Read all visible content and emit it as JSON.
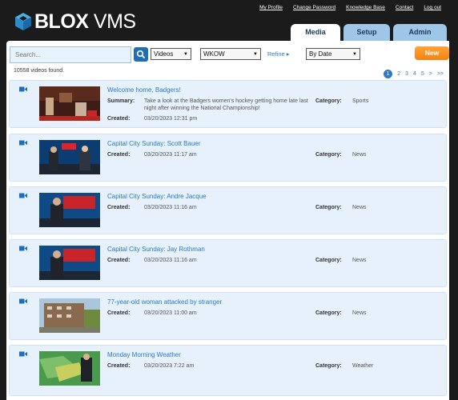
{
  "brand": {
    "name_bold": "BLOX",
    "name_thin": " VMS"
  },
  "toplinks": [
    "My Profile",
    "Change Password",
    "Knowledge Base",
    "Contact",
    "Log out"
  ],
  "tabs": [
    {
      "label": "Media",
      "active": true
    },
    {
      "label": "Setup",
      "active": false
    },
    {
      "label": "Admin",
      "active": false
    }
  ],
  "toolbar": {
    "search_placeholder": "Search...",
    "type_value": "Videos",
    "station_value": "WKOW",
    "refine_label": "Refine ▸",
    "sort_value": "By Date",
    "new_label": "New"
  },
  "results": {
    "count_text": "10558 videos found."
  },
  "pager": {
    "current": "1",
    "pages": [
      "2",
      "3",
      "4",
      "5",
      ">",
      ">>"
    ]
  },
  "labels": {
    "summary": "Summary:",
    "created": "Created:",
    "category": "Category:"
  },
  "videos": [
    {
      "title": "Welcome home, Badgers!",
      "summary": "Take a look at the Badgers women's hockey getting home late last night after winning the National Championship!",
      "created": "03/20/2023 12:31 pm",
      "category": "Sports",
      "thumb": "hockey"
    },
    {
      "title": "Capital City Sunday: Scott Bauer",
      "summary": "",
      "created": "03/20/2023 11:17 am",
      "category": "News",
      "thumb": "studio2"
    },
    {
      "title": "Capital City Sunday: Andre Jacque",
      "summary": "",
      "created": "03/20/2023 11:16 am",
      "category": "News",
      "thumb": "studio1"
    },
    {
      "title": "Capital City Sunday: Jay Rothman",
      "summary": "",
      "created": "03/20/2023 11:16 am",
      "category": "News",
      "thumb": "studio1"
    },
    {
      "title": "77-year-old woman attacked by stranger",
      "summary": "",
      "created": "03/20/2023 11:00 am",
      "category": "News",
      "thumb": "building"
    },
    {
      "title": "Monday Morning Weather",
      "summary": "",
      "created": "03/20/2023 7:22 am",
      "category": "Weather",
      "thumb": "weather"
    }
  ]
}
